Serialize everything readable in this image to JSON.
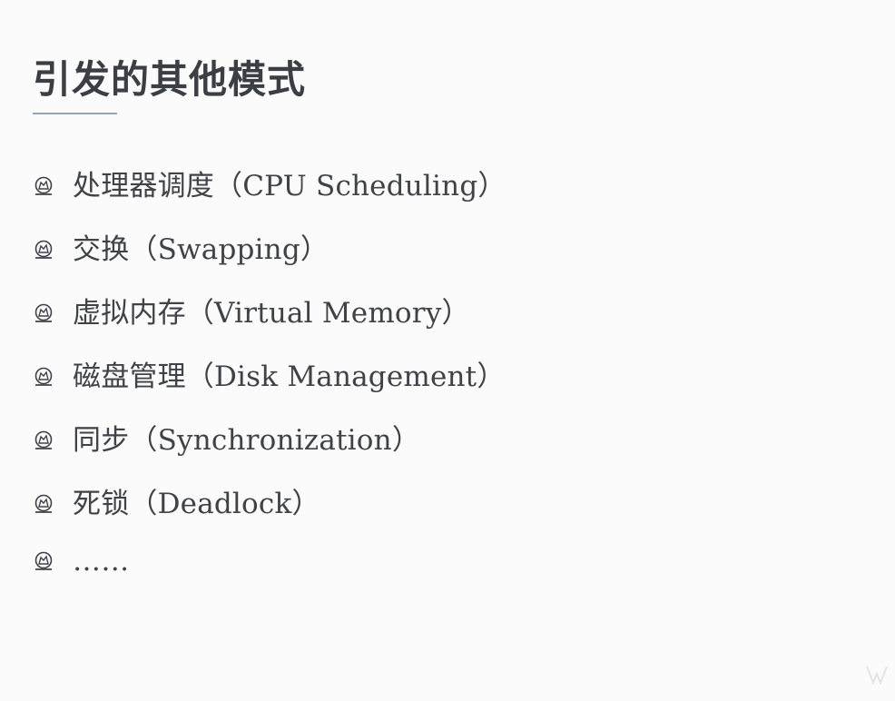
{
  "slide": {
    "title": "引发的其他模式",
    "bullets": [
      {
        "text": "处理器调度（CPU Scheduling）",
        "icon": "bullet-emblem-icon"
      },
      {
        "text": "交换（Swapping）",
        "icon": "bullet-emblem-icon"
      },
      {
        "text": "虚拟内存（Virtual Memory）",
        "icon": "bullet-emblem-icon"
      },
      {
        "text": "磁盘管理（Disk Management）",
        "icon": "bullet-emblem-icon"
      },
      {
        "text": "同步（Synchronization）",
        "icon": "bullet-emblem-icon"
      },
      {
        "text": "死锁（Deadlock）",
        "icon": "bullet-emblem-icon"
      },
      {
        "text": "……",
        "icon": "bullet-emblem-icon"
      }
    ]
  },
  "colors": {
    "background": "#fbfbfb",
    "text": "#3f4247",
    "title_underline": "#8fa6be"
  }
}
